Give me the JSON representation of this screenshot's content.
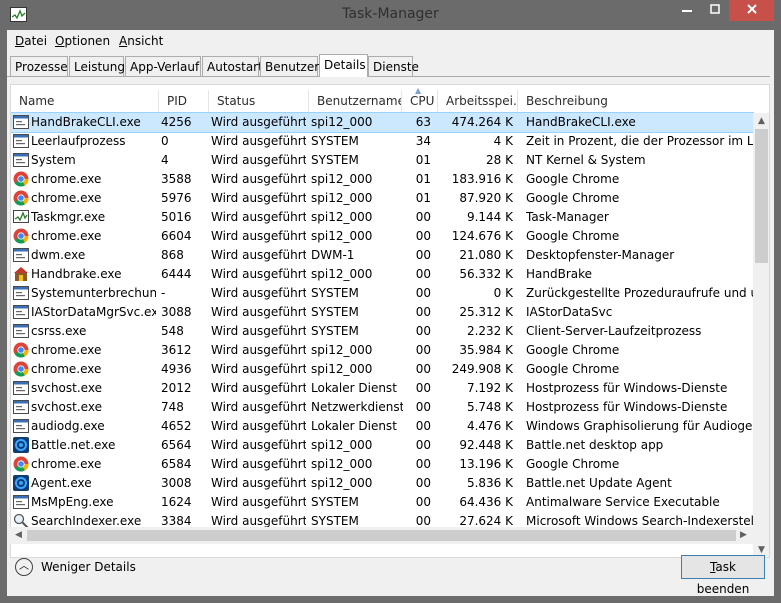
{
  "window": {
    "title": "Task-Manager"
  },
  "menu": [
    {
      "label": "Datei",
      "access": "D"
    },
    {
      "label": "Optionen",
      "access": "O"
    },
    {
      "label": "Ansicht",
      "access": "A"
    }
  ],
  "tabs": [
    "Prozesse",
    "Leistung",
    "App-Verlauf",
    "Autostart",
    "Benutzer",
    "Details",
    "Dienste"
  ],
  "active_tab": "Details",
  "columns": {
    "name": "Name",
    "pid": "PID",
    "status": "Status",
    "user": "Benutzername",
    "cpu": "CPU",
    "mem": "Arbeitsspei...",
    "desc": "Beschreibung"
  },
  "sort_column": "CPU",
  "rows": [
    {
      "icon": "console-icon",
      "name": "HandBrakeCLI.exe",
      "pid": "4256",
      "status": "Wird ausgeführt",
      "user": "spi12_000",
      "cpu": "63",
      "mem": "474.264 K",
      "desc": "HandBrakeCLI.exe",
      "selected": true
    },
    {
      "icon": "console-icon",
      "name": "Leerlaufprozess",
      "pid": "0",
      "status": "Wird ausgeführt",
      "user": "SYSTEM",
      "cpu": "34",
      "mem": "4 K",
      "desc": "Zeit in Prozent, die der Prozessor im Leerlau..."
    },
    {
      "icon": "console-icon",
      "name": "System",
      "pid": "4",
      "status": "Wird ausgeführt",
      "user": "SYSTEM",
      "cpu": "01",
      "mem": "28 K",
      "desc": "NT Kernel & System"
    },
    {
      "icon": "chrome-icon",
      "name": "chrome.exe",
      "pid": "3588",
      "status": "Wird ausgeführt",
      "user": "spi12_000",
      "cpu": "01",
      "mem": "183.916 K",
      "desc": "Google Chrome"
    },
    {
      "icon": "chrome-icon",
      "name": "chrome.exe",
      "pid": "5976",
      "status": "Wird ausgeführt",
      "user": "spi12_000",
      "cpu": "01",
      "mem": "87.920 K",
      "desc": "Google Chrome"
    },
    {
      "icon": "taskmgr-icon",
      "name": "Taskmgr.exe",
      "pid": "5016",
      "status": "Wird ausgeführt",
      "user": "spi12_000",
      "cpu": "00",
      "mem": "9.144 K",
      "desc": "Task-Manager"
    },
    {
      "icon": "chrome-icon",
      "name": "chrome.exe",
      "pid": "6604",
      "status": "Wird ausgeführt",
      "user": "spi12_000",
      "cpu": "00",
      "mem": "124.676 K",
      "desc": "Google Chrome"
    },
    {
      "icon": "console-icon",
      "name": "dwm.exe",
      "pid": "868",
      "status": "Wird ausgeführt",
      "user": "DWM-1",
      "cpu": "00",
      "mem": "21.080 K",
      "desc": "Desktopfenster-Manager"
    },
    {
      "icon": "handbrake-icon",
      "name": "Handbrake.exe",
      "pid": "6444",
      "status": "Wird ausgeführt",
      "user": "spi12_000",
      "cpu": "00",
      "mem": "56.332 K",
      "desc": "HandBrake"
    },
    {
      "icon": "console-icon",
      "name": "Systemunterbrechun...",
      "pid": "-",
      "status": "Wird ausgeführt",
      "user": "SYSTEM",
      "cpu": "00",
      "mem": "0 K",
      "desc": "Zurückgestellte Prozeduraufrufe und unter..."
    },
    {
      "icon": "console-icon",
      "name": "IAStorDataMgrSvc.exe",
      "pid": "3088",
      "status": "Wird ausgeführt",
      "user": "SYSTEM",
      "cpu": "00",
      "mem": "25.312 K",
      "desc": "IAStorDataSvc"
    },
    {
      "icon": "console-icon",
      "name": "csrss.exe",
      "pid": "548",
      "status": "Wird ausgeführt",
      "user": "SYSTEM",
      "cpu": "00",
      "mem": "2.232 K",
      "desc": "Client-Server-Laufzeitprozess"
    },
    {
      "icon": "chrome-icon",
      "name": "chrome.exe",
      "pid": "3612",
      "status": "Wird ausgeführt",
      "user": "spi12_000",
      "cpu": "00",
      "mem": "35.984 K",
      "desc": "Google Chrome"
    },
    {
      "icon": "chrome-icon",
      "name": "chrome.exe",
      "pid": "4936",
      "status": "Wird ausgeführt",
      "user": "spi12_000",
      "cpu": "00",
      "mem": "249.908 K",
      "desc": "Google Chrome"
    },
    {
      "icon": "console-icon",
      "name": "svchost.exe",
      "pid": "2012",
      "status": "Wird ausgeführt",
      "user": "Lokaler Dienst",
      "cpu": "00",
      "mem": "7.192 K",
      "desc": "Hostprozess für Windows-Dienste"
    },
    {
      "icon": "console-icon",
      "name": "svchost.exe",
      "pid": "748",
      "status": "Wird ausgeführt",
      "user": "Netzwerkdienst",
      "cpu": "00",
      "mem": "5.748 K",
      "desc": "Hostprozess für Windows-Dienste"
    },
    {
      "icon": "console-icon",
      "name": "audiodg.exe",
      "pid": "4652",
      "status": "Wird ausgeführt",
      "user": "Lokaler Dienst",
      "cpu": "00",
      "mem": "4.476 K",
      "desc": "Windows Graphisolierung für Audiogeräte"
    },
    {
      "icon": "battlenet-icon",
      "name": "Battle.net.exe",
      "pid": "6564",
      "status": "Wird ausgeführt",
      "user": "spi12_000",
      "cpu": "00",
      "mem": "92.448 K",
      "desc": "Battle.net desktop app"
    },
    {
      "icon": "chrome-icon",
      "name": "chrome.exe",
      "pid": "6584",
      "status": "Wird ausgeführt",
      "user": "spi12_000",
      "cpu": "00",
      "mem": "13.196 K",
      "desc": "Google Chrome"
    },
    {
      "icon": "battlenet-icon",
      "name": "Agent.exe",
      "pid": "3008",
      "status": "Wird ausgeführt",
      "user": "spi12_000",
      "cpu": "00",
      "mem": "5.836 K",
      "desc": "Battle.net Update Agent"
    },
    {
      "icon": "console-icon",
      "name": "MsMpEng.exe",
      "pid": "1624",
      "status": "Wird ausgeführt",
      "user": "SYSTEM",
      "cpu": "00",
      "mem": "64.436 K",
      "desc": "Antimalware Service Executable"
    },
    {
      "icon": "search-indexer-icon",
      "name": "SearchIndexer.exe",
      "pid": "3384",
      "status": "Wird ausgeführt",
      "user": "SYSTEM",
      "cpu": "00",
      "mem": "27.624 K",
      "desc": "Microsoft Windows Search-Indexerstellung"
    }
  ],
  "footer": {
    "less_details": "Weniger Details",
    "end_task": "Task beenden"
  },
  "colors": {
    "titlebar": "#6b6b6b",
    "close_button": "#c7504a",
    "selection": "#cce8ff"
  }
}
